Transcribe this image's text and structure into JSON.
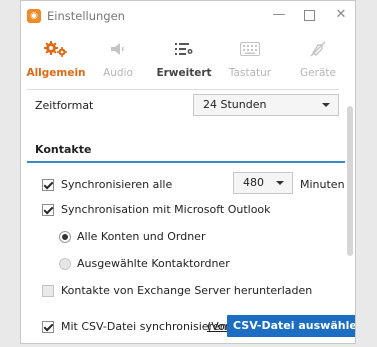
{
  "window": {
    "title": "Einstellungen",
    "minimize": "—",
    "close": "✕"
  },
  "tabs": [
    {
      "label": "Allgemein",
      "icon": "gears-icon",
      "state": "active"
    },
    {
      "label": "Audio",
      "icon": "speaker-icon",
      "state": "inactive"
    },
    {
      "label": "Erweitert",
      "icon": "advanced-list-icon",
      "state": "strong"
    },
    {
      "label": "Tastatur",
      "icon": "keyboard-icon",
      "state": "inactive"
    },
    {
      "label": "Geräte",
      "icon": "device-disabled-icon",
      "state": "inactive"
    }
  ],
  "time_format": {
    "label": "Zeitformat",
    "value": "24 Stunden"
  },
  "contacts": {
    "title": "Kontakte",
    "sync_all": {
      "label": "Synchronisieren alle",
      "checked": true,
      "interval": "480",
      "unit": "Minuten"
    },
    "sync_outlook": {
      "label": "Synchronisation mit Microsoft Outlook",
      "checked": true
    },
    "radio_all": {
      "label": "Alle Konten und Ordner",
      "checked": true
    },
    "radio_selected": {
      "label": "Ausgewählte Kontaktordner",
      "checked": false
    },
    "exchange": {
      "label": "Kontakte von Exchange Server herunterladen",
      "checked": false
    },
    "csv": {
      "label": "Mit CSV-Datei synchronisieren",
      "link": "(Vorla",
      "button": "CSV-Datei auswählen",
      "checked": true
    }
  },
  "colors": {
    "accent": "#e06a14",
    "primary": "#1b6ec2",
    "section_line": "#3a89c9"
  }
}
